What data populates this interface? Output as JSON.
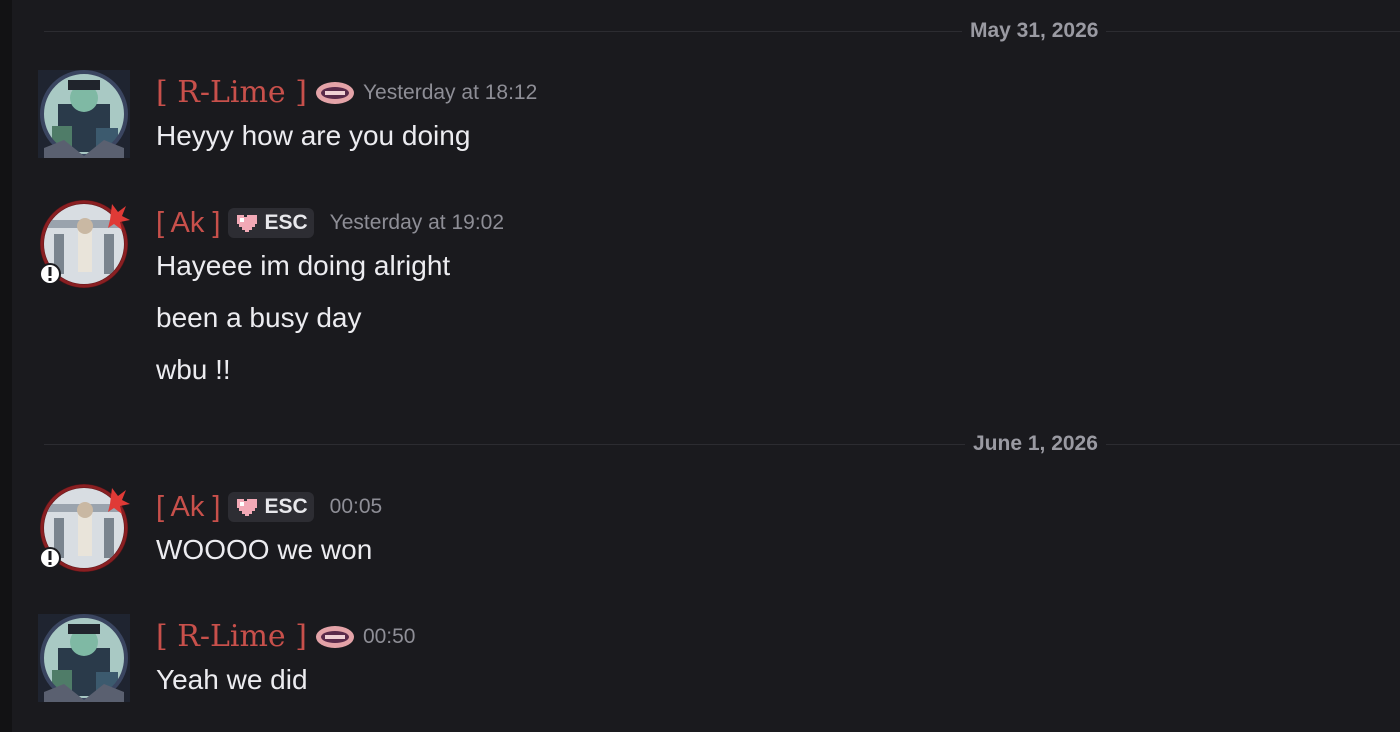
{
  "dividers": [
    {
      "date": "May 31, 2026"
    },
    {
      "date": "June 1, 2026"
    }
  ],
  "messages": [
    {
      "username": "[ R-Lime ]",
      "timestamp": "Yesterday at 18:12",
      "badge_icon": "guild-badge-icon",
      "lines": [
        "Heyyy how are you doing"
      ]
    },
    {
      "username": "[ Ak ]",
      "tag": "ESC",
      "tag_icon": "pixel-heart-icon",
      "timestamp": "Yesterday at 19:02",
      "lines": [
        "Hayeee im doing alright",
        "been a busy day",
        "wbu !!"
      ]
    },
    {
      "username": "[ Ak ]",
      "tag": "ESC",
      "tag_icon": "pixel-heart-icon",
      "timestamp": "00:05",
      "lines": [
        "WOOOO we won"
      ]
    },
    {
      "username": "[ R-Lime ]",
      "timestamp": "00:50",
      "badge_icon": "guild-badge-icon",
      "lines": [
        "Yeah we did"
      ]
    }
  ],
  "colors": {
    "background": "#1a1a1e",
    "username": "#c8504b",
    "message_text": "#ececf0",
    "timestamp": "#8e8e96"
  }
}
